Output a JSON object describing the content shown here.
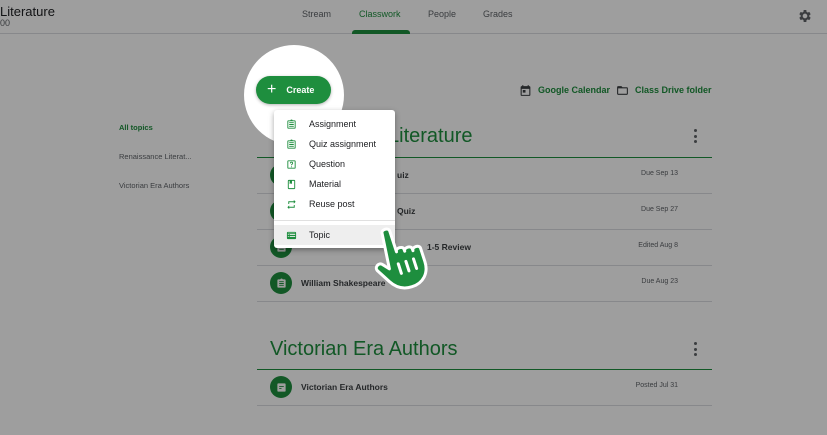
{
  "header": {
    "class_title": "Literature",
    "class_subtitle": "00",
    "tabs": [
      {
        "label": "Stream"
      },
      {
        "label": "Classwork"
      },
      {
        "label": "People"
      },
      {
        "label": "Grades"
      }
    ],
    "settings_icon": "gear-icon"
  },
  "toolbar": {
    "create_label": "Create",
    "calendar_label": "Google Calendar",
    "drive_label": "Class Drive folder"
  },
  "topics_nav": {
    "items": [
      {
        "label": "All topics"
      },
      {
        "label": "Renaissance Literat..."
      },
      {
        "label": "Victorian Era Authors"
      }
    ]
  },
  "create_menu": {
    "items": [
      {
        "label": "Assignment",
        "icon": "assignment-icon"
      },
      {
        "label": "Quiz assignment",
        "icon": "quiz-assignment-icon"
      },
      {
        "label": "Question",
        "icon": "question-icon"
      },
      {
        "label": "Material",
        "icon": "material-icon"
      },
      {
        "label": "Reuse post",
        "icon": "reuse-icon"
      },
      {
        "label": "Topic",
        "icon": "topic-icon"
      }
    ]
  },
  "sections": [
    {
      "title_visible": "Literature",
      "items": [
        {
          "title": "uiz",
          "date": "Due Sep 13"
        },
        {
          "title": "Quiz",
          "date": "Due Sep 27"
        },
        {
          "title": "1-5 Review",
          "date": "Edited Aug 8"
        },
        {
          "title": "William Shakespeare",
          "date": "Due Aug 23"
        }
      ]
    },
    {
      "title": "Victorian Era Authors",
      "items": [
        {
          "title": "Victorian Era Authors",
          "date": "Posted Jul 31"
        }
      ]
    }
  ],
  "colors": {
    "accent": "#1e8e3e",
    "text": "#3c4043",
    "secondary_text": "#5f6368"
  }
}
